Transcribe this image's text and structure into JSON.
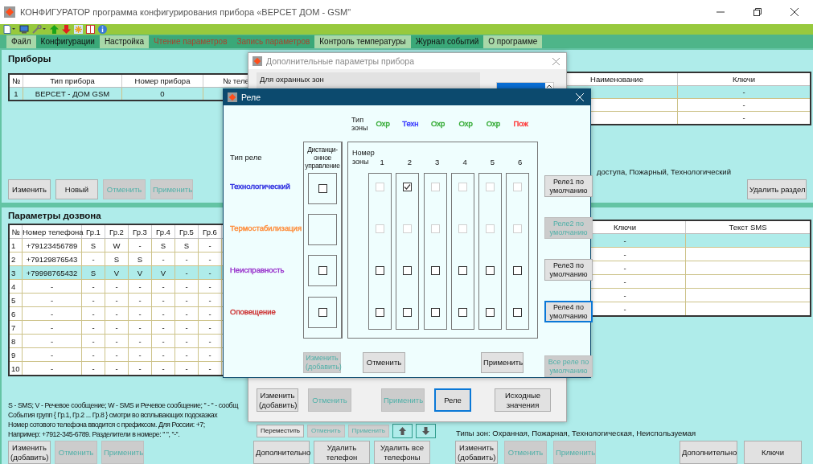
{
  "window": {
    "title": "КОНФИГУРАТОР программа конфигурирования прибора «ВЕРСЕТ ДОМ - GSM\""
  },
  "menu": [
    {
      "label": "Файл",
      "highlighted": false,
      "disabled": false
    },
    {
      "label": "Конфигурации",
      "highlighted": true,
      "disabled": false
    },
    {
      "label": "Настройка",
      "highlighted": false,
      "disabled": false
    },
    {
      "label": "Чтение параметров",
      "highlighted": true,
      "disabled": true
    },
    {
      "label": "Запись параметров",
      "highlighted": true,
      "disabled": true
    },
    {
      "label": "Контроль температуры",
      "highlighted": false,
      "disabled": false
    },
    {
      "label": "Журнал событий",
      "highlighted": true,
      "disabled": false
    },
    {
      "label": "О программе",
      "highlighted": false,
      "disabled": false
    }
  ],
  "devices": {
    "title": "Приборы",
    "columns": [
      "№",
      "Тип прибора",
      "Номер прибора",
      "№ теле"
    ],
    "rows": [
      {
        "cells": [
          "1",
          "ВЕРСЕТ - ДОМ GSM",
          "0"
        ],
        "selected": true
      }
    ],
    "buttons": [
      {
        "label": "Изменить",
        "disabled": false
      },
      {
        "label": "Новый",
        "disabled": false
      },
      {
        "label": "Отменить",
        "disabled": true
      },
      {
        "label": "Применить",
        "disabled": true
      }
    ]
  },
  "sections": {
    "columns": [
      "Наименование",
      "Ключи"
    ],
    "rows": [
      {
        "keys": "-",
        "selected": true
      },
      {
        "keys": "-",
        "selected": false
      },
      {
        "keys": "-",
        "selected": false
      }
    ],
    "note": "доступа, Пожарный, Технологический",
    "delete_button": "Удалить раздел"
  },
  "dialing": {
    "title": "Параметры дозвона",
    "columns": [
      "№",
      "Номер телефона",
      "Гр.1",
      "Гр.2",
      "Гр.3",
      "Гр.4",
      "Гр.5",
      "Гр.6"
    ],
    "rows": [
      {
        "cells": [
          "1",
          "+79123456789",
          "S",
          "W",
          "-",
          "S",
          "S",
          "-"
        ],
        "selected": false
      },
      {
        "cells": [
          "2",
          "+79129876543",
          "-",
          "S",
          "S",
          "-",
          "-",
          "-"
        ],
        "selected": false
      },
      {
        "cells": [
          "3",
          "+79998765432",
          "S",
          "V",
          "V",
          "V",
          "-",
          "-"
        ],
        "selected": true
      },
      {
        "cells": [
          "4",
          "-",
          "-",
          "-",
          "-",
          "-",
          "-",
          "-"
        ],
        "selected": false
      },
      {
        "cells": [
          "5",
          "-",
          "-",
          "-",
          "-",
          "-",
          "-",
          "-"
        ],
        "selected": false
      },
      {
        "cells": [
          "6",
          "-",
          "-",
          "-",
          "-",
          "-",
          "-",
          "-"
        ],
        "selected": false
      },
      {
        "cells": [
          "7",
          "-",
          "-",
          "-",
          "-",
          "-",
          "-",
          "-"
        ],
        "selected": false
      },
      {
        "cells": [
          "8",
          "-",
          "-",
          "-",
          "-",
          "-",
          "-",
          "-"
        ],
        "selected": false
      },
      {
        "cells": [
          "9",
          "-",
          "-",
          "-",
          "-",
          "-",
          "-",
          "-"
        ],
        "selected": false
      },
      {
        "cells": [
          "10",
          "-",
          "-",
          "-",
          "-",
          "-",
          "-",
          "-"
        ],
        "selected": false
      }
    ],
    "legend": [
      "S - SMS;  V - Речевое сообщение;  W - SMS и Речевое сообщение; \" - \" - сообщ",
      "События групп { Гр.1, Гр.2 ... Гр.8 } смотри во всплывающих подсказках",
      "Номер сотового телефона вводится с префиксом. Для России: +7;",
      "Например: +7912-345-6789. Разделители в номере: \" \", \"-\"."
    ],
    "buttons": [
      {
        "label": "Изменить (добавить)",
        "disabled": false
      },
      {
        "label": "Отменить",
        "disabled": true
      },
      {
        "label": "Применить",
        "disabled": true
      }
    ],
    "row_buttons": [
      {
        "label": "Переместить",
        "disabled": false
      },
      {
        "label": "Отменить",
        "disabled": true
      },
      {
        "label": "Применить",
        "disabled": true
      }
    ],
    "more_buttons": [
      {
        "label": "Дополнительно",
        "disabled": false
      },
      {
        "label": "Удалить телефон",
        "disabled": false
      },
      {
        "label": "Удалить все телефоны",
        "disabled": false
      }
    ]
  },
  "messages": {
    "columns": [
      "Ключи",
      "Текст SMS"
    ],
    "rows": [
      {
        "keys": "-",
        "selected": true
      },
      {
        "keys": "-",
        "selected": false
      },
      {
        "keys": "-",
        "selected": false
      },
      {
        "keys": "-",
        "selected": false
      },
      {
        "keys": "-",
        "selected": false
      },
      {
        "keys": "-",
        "selected": false
      }
    ],
    "note": "Типы зон: Охранная, Пожарная, Технологическая, Неиспользуемая",
    "buttons": [
      {
        "label": "Изменить (добавить)",
        "disabled": false
      },
      {
        "label": "Отменить",
        "disabled": true
      },
      {
        "label": "Применить",
        "disabled": true
      }
    ],
    "extra_buttons": [
      {
        "label": "Дополнительно",
        "disabled": false
      },
      {
        "label": "Ключи",
        "disabled": false
      }
    ]
  },
  "extra_dialog": {
    "title": "Дополнительные параметры прибора",
    "group": "Для охранных зон",
    "buttons": [
      {
        "label": "Изменить (добавить)",
        "disabled": false,
        "focused": false
      },
      {
        "label": "Отменить",
        "disabled": true,
        "focused": false
      },
      {
        "label": "Применить",
        "disabled": true,
        "focused": false
      },
      {
        "label": "Реле",
        "disabled": false,
        "focused": true
      },
      {
        "label": "Исходные значения",
        "disabled": false,
        "focused": false
      }
    ]
  },
  "relay_dialog": {
    "title": "Реле",
    "zone_type_label": "Тип зоны",
    "zone_types": [
      {
        "label": "Охр",
        "color": "#33aa33"
      },
      {
        "label": "Техн",
        "color": "#3333ff"
      },
      {
        "label": "Охр",
        "color": "#33aa33"
      },
      {
        "label": "Охр",
        "color": "#33aa33"
      },
      {
        "label": "Охр",
        "color": "#33aa33"
      },
      {
        "label": "Пож",
        "color": "#ff3333"
      }
    ],
    "relay_type_label": "Тип реле",
    "remote_label": "Дистанци-онное управление",
    "zone_number_label": "Номер зоны",
    "zones": [
      "1",
      "2",
      "3",
      "4",
      "5",
      "6"
    ],
    "relays": [
      {
        "name": "Технологический",
        "color": "#2828e0",
        "remote": {
          "checked": false
        },
        "zones": [
          {
            "checked": false,
            "disabled": true
          },
          {
            "checked": true,
            "disabled": false
          },
          {
            "checked": false,
            "disabled": true
          },
          {
            "checked": false,
            "disabled": true
          },
          {
            "checked": false,
            "disabled": true
          },
          {
            "checked": false,
            "disabled": true
          }
        ],
        "default_button": {
          "label": "Реле1 по умолчанию",
          "disabled": false,
          "focused": false
        }
      },
      {
        "name": "Термостабилизация",
        "color": "#ff8c3a",
        "zones": [
          {
            "checked": false,
            "disabled": true
          },
          {
            "checked": false,
            "disabled": true
          },
          {
            "checked": false,
            "disabled": true
          },
          {
            "checked": false,
            "disabled": true
          },
          {
            "checked": false,
            "disabled": true
          },
          {
            "checked": false,
            "disabled": true
          }
        ],
        "default_button": {
          "label": "Реле2 по умолчанию",
          "disabled": true,
          "focused": false
        }
      },
      {
        "name": "Неисправность",
        "color": "#9933cc",
        "remote": {
          "checked": false
        },
        "zones": [
          {
            "checked": false,
            "disabled": false
          },
          {
            "checked": false,
            "disabled": false
          },
          {
            "checked": false,
            "disabled": false
          },
          {
            "checked": false,
            "disabled": false
          },
          {
            "checked": false,
            "disabled": false
          },
          {
            "checked": false,
            "disabled": false
          }
        ],
        "default_button": {
          "label": "Реле3 по умолчанию",
          "disabled": false,
          "focused": false
        }
      },
      {
        "name": "Оповещение",
        "color": "#cc3333",
        "remote": {
          "checked": false
        },
        "zones": [
          {
            "checked": false,
            "disabled": false
          },
          {
            "checked": false,
            "disabled": false
          },
          {
            "checked": false,
            "disabled": false
          },
          {
            "checked": false,
            "disabled": false
          },
          {
            "checked": false,
            "disabled": false
          },
          {
            "checked": false,
            "disabled": false
          }
        ],
        "default_button": {
          "label": "Реле4 по умолчанию",
          "disabled": false,
          "focused": true
        }
      }
    ],
    "buttons": [
      {
        "label": "Изменить (добавить)",
        "disabled": true
      },
      {
        "label": "Отменить",
        "disabled": false
      },
      {
        "label": "Применить",
        "disabled": false
      },
      {
        "label": "Все реле по умолчанию",
        "disabled": true
      }
    ]
  }
}
